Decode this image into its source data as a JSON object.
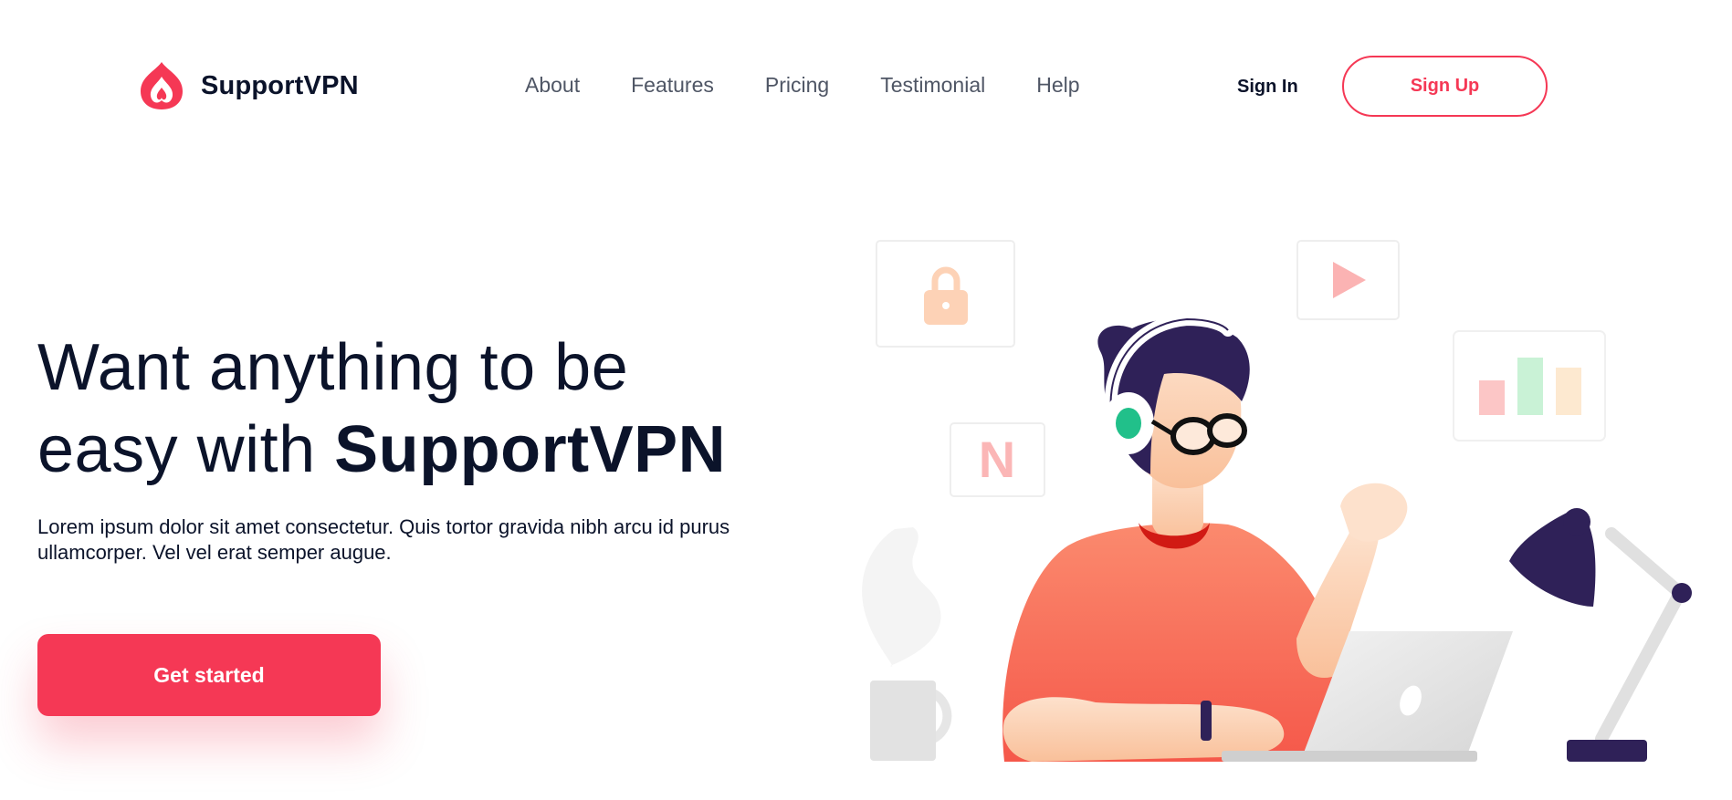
{
  "header": {
    "brand": "SupportVPN",
    "nav": [
      "About",
      "Features",
      "Pricing",
      "Testimonial",
      "Help"
    ],
    "signin_label": "Sign In",
    "signup_label": "Sign Up"
  },
  "hero": {
    "headline_line1": "Want anything to be",
    "headline_line2_prefix": "easy with ",
    "headline_brand": "SupportVPN",
    "subtext": "Lorem ipsum dolor sit amet consectetur. Quis tortor gravida nibh arcu id purus ullamcorper. Vel vel erat semper augue.",
    "cta_label": "Get started",
    "illustration_badge_letter": "N"
  },
  "colors": {
    "accent": "#f53855",
    "dark_text": "#0b132a",
    "nav_text": "#4f5665",
    "illustration_navy": "#2f2158"
  },
  "icons": [
    "vpn-logo-icon",
    "lock-icon",
    "play-icon",
    "bar-chart-icon",
    "netflix-icon",
    "coffee-mug-icon",
    "desk-lamp-icon",
    "laptop-icon"
  ]
}
